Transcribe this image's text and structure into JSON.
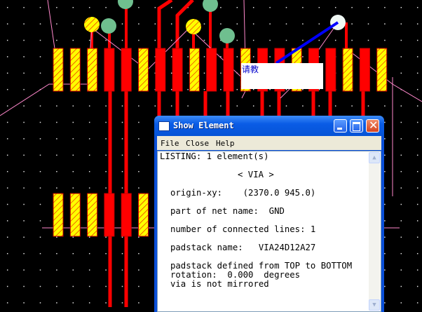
{
  "tooltip": {
    "text": "请教"
  },
  "window": {
    "title": "Show Element",
    "menu": [
      "File",
      "Close",
      "Help"
    ],
    "lines": {
      "listing": "LISTING: 1 element(s)",
      "type": "< VIA >",
      "origin": "origin-xy:    (2370.0 945.0)",
      "net": "part of net name:  GND",
      "connected": "number of connected lines: 1",
      "padstack": "padstack name:   VIA24D12A27",
      "defined": "padstack defined from TOP to BOTTOM",
      "rotation": "rotation:  0.000  degrees",
      "mirror": "via is not mirrored"
    }
  },
  "colors": {
    "background": "#000000",
    "pad_red": "#ff0000",
    "pad_yellow": "#ffff00",
    "via_green": "#6fbf8f",
    "ratsnest": "#ff88cc",
    "highlight": "#0000ff"
  }
}
